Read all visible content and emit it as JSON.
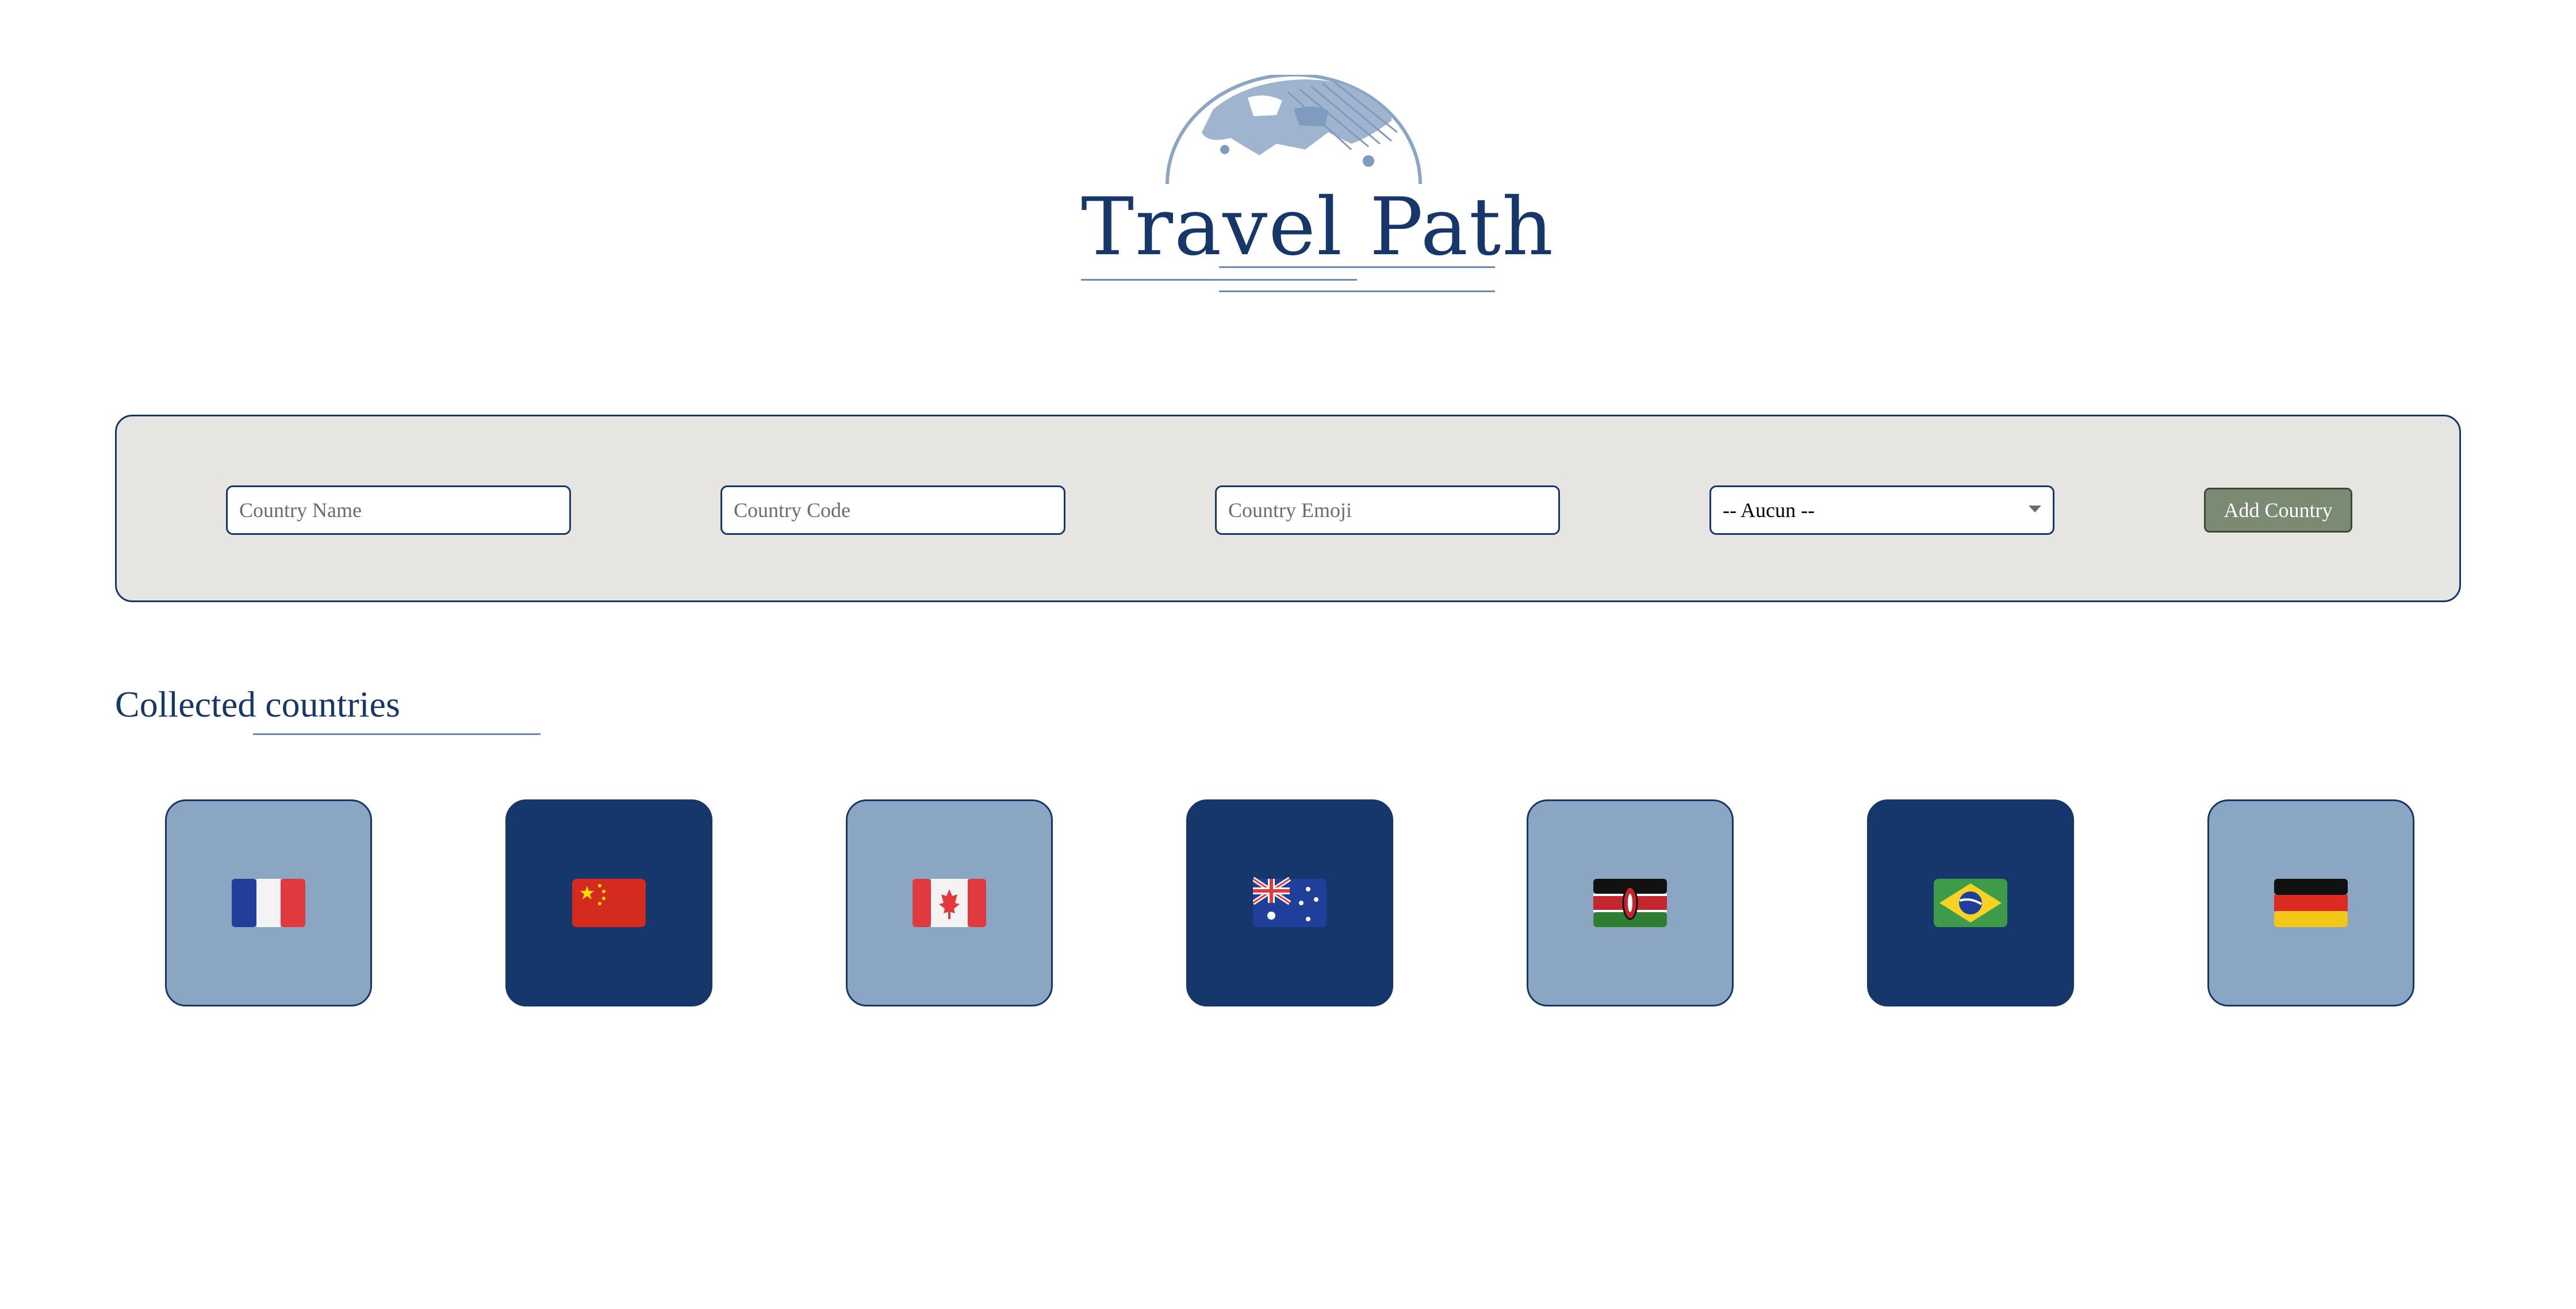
{
  "logo": {
    "title": "Travel Path",
    "icon": "globe-icon"
  },
  "form": {
    "country_name_placeholder": "Country Name",
    "country_code_placeholder": "Country Code",
    "country_emoji_placeholder": "Country Emoji",
    "select_value": "-- Aucun --",
    "add_button_label": "Add Country"
  },
  "collected": {
    "title": "Collected countries",
    "flags": [
      {
        "emoji": "🇫🇷",
        "icon": "france-flag-icon",
        "style": "light"
      },
      {
        "emoji": "🇨🇳",
        "icon": "china-flag-icon",
        "style": "dark"
      },
      {
        "emoji": "🇨🇦",
        "icon": "canada-flag-icon",
        "style": "light"
      },
      {
        "emoji": "🇦🇺",
        "icon": "australia-flag-icon",
        "style": "dark"
      },
      {
        "emoji": "🇰🇪",
        "icon": "kenya-flag-icon",
        "style": "light"
      },
      {
        "emoji": "🇧🇷",
        "icon": "brazil-flag-icon",
        "style": "dark"
      },
      {
        "emoji": "🇩🇪",
        "icon": "germany-flag-icon",
        "style": "light"
      }
    ]
  },
  "colors": {
    "primary": "#17376b",
    "tile_light": "#8aa6c3",
    "tile_dark": "#16376b",
    "panel_bg": "#e6e5e1",
    "button_bg": "#7b8a72"
  }
}
